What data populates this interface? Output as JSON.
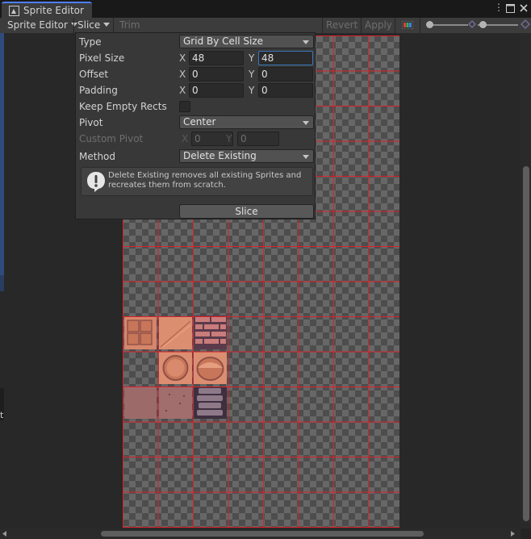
{
  "window": {
    "tab_title": "Sprite Editor",
    "tab_icon": "sprite-editor-icon",
    "controls": [
      "menu-dots-icon",
      "maximize-icon",
      "close-icon"
    ]
  },
  "toolbar": {
    "sprite_editor_menu": "Sprite Editor",
    "slice_menu": "Slice",
    "trim": "Trim",
    "revert": "Revert",
    "apply": "Apply",
    "color_toggle_icon": "rgb-channel-icon"
  },
  "slice_popup": {
    "type_label": "Type",
    "type_value": "Grid By Cell Size",
    "pixel_size_label": "Pixel Size",
    "pixel_size_x": "48",
    "pixel_size_y": "48",
    "offset_label": "Offset",
    "offset_x": "0",
    "offset_y": "0",
    "padding_label": "Padding",
    "padding_x": "0",
    "padding_y": "0",
    "keep_empty_label": "Keep Empty Rects",
    "keep_empty_checked": false,
    "pivot_label": "Pivot",
    "pivot_value": "Center",
    "custom_pivot_label": "Custom Pivot",
    "custom_pivot_x": "0",
    "custom_pivot_y": "0",
    "method_label": "Method",
    "method_value": "Delete Existing",
    "help_text": "Delete Existing removes all existing Sprites and recreates them from scratch.",
    "slice_button": "Slice",
    "axis_x": "X",
    "axis_y": "Y"
  },
  "colors": {
    "grid_line": "#d8232b",
    "accent_focus": "#3a79bb",
    "tile_base": "#d6866a",
    "tile_dark": "#4a3447"
  }
}
